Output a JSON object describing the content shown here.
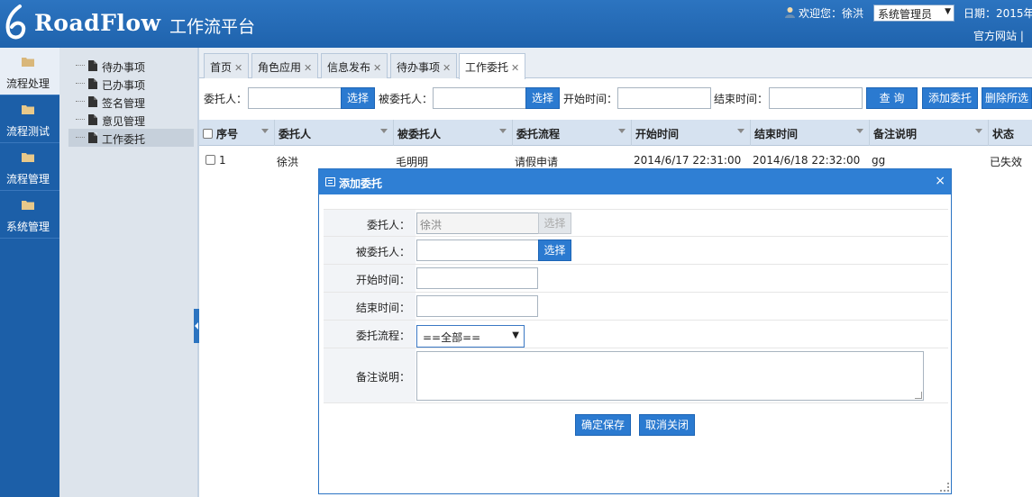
{
  "header": {
    "logo_text": "RoadFlow",
    "platform_name": "工作流平台",
    "welcome": "欢迎您：徐洪",
    "role": "系统管理员",
    "date_label": "日期：2015年",
    "site_link": "官方网站  |"
  },
  "leftnav": [
    {
      "label": "流程处理"
    },
    {
      "label": "流程测试"
    },
    {
      "label": "流程管理"
    },
    {
      "label": "系统管理"
    }
  ],
  "tree": [
    {
      "label": "待办事项"
    },
    {
      "label": "已办事项"
    },
    {
      "label": "签名管理"
    },
    {
      "label": "意见管理"
    },
    {
      "label": "工作委托"
    }
  ],
  "tabs": [
    {
      "label": "首页"
    },
    {
      "label": "角色应用"
    },
    {
      "label": "信息发布"
    },
    {
      "label": "待办事项"
    },
    {
      "label": "工作委托"
    }
  ],
  "query": {
    "delegator_label": "委托人：",
    "select_label": "选择",
    "delegatee_label": "被委托人：",
    "start_label": "开始时间：",
    "end_label": "结束时间：",
    "search_btn": "查 询",
    "add_btn": "添加委托",
    "delete_btn": "删除所选"
  },
  "grid": {
    "columns": [
      "序号",
      "委托人",
      "被委托人",
      "委托流程",
      "开始时间",
      "结束时间",
      "备注说明",
      "状态"
    ],
    "rows": [
      {
        "no": "1",
        "delegator": "徐洪",
        "delegatee": "毛明明",
        "flow": "请假申请",
        "start": "2014/6/17 22:31:00",
        "end": "2014/6/18 22:32:00",
        "remark": "gg",
        "status": "已失效"
      }
    ]
  },
  "dialog": {
    "title": "添加委托",
    "close": "×",
    "delegator_label": "委托人：",
    "delegator_value": "徐洪",
    "delegator_select": "选择",
    "delegatee_label": "被委托人：",
    "delegatee_select": "选择",
    "start_label": "开始时间：",
    "end_label": "结束时间：",
    "flow_label": "委托流程：",
    "flow_value": "==全部==",
    "remark_label": "备注说明：",
    "save_btn": "确定保存",
    "cancel_btn": "取消关闭"
  }
}
